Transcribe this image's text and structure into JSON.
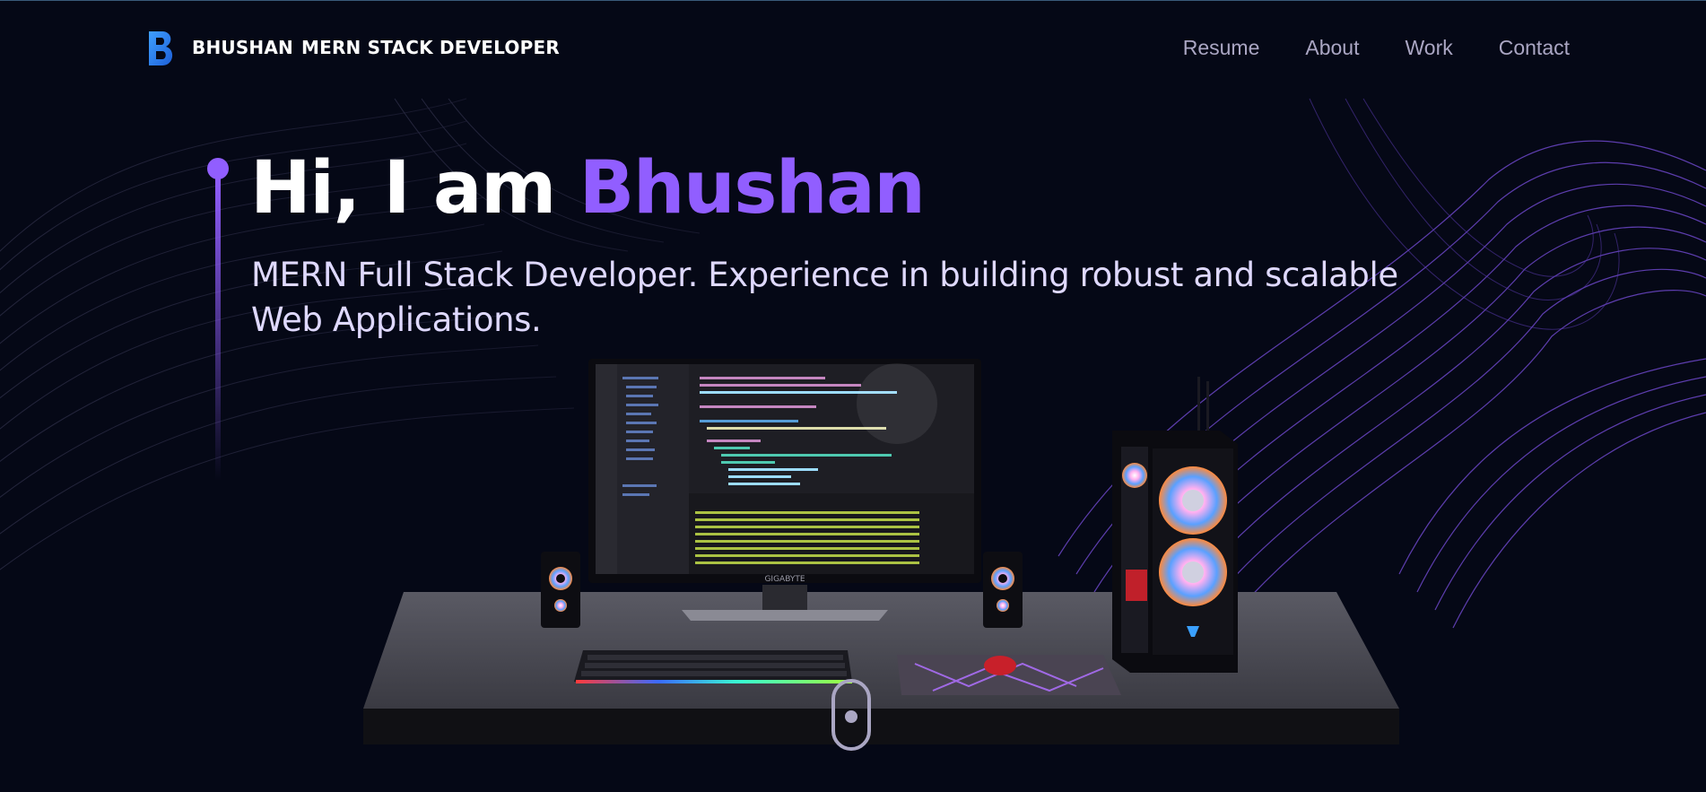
{
  "brand": {
    "first": "BHUSHAN",
    "second": "MERN STACK DEVELOPER",
    "logo_icon": "b-logo-icon"
  },
  "nav": {
    "items": [
      {
        "label": "Resume"
      },
      {
        "label": "About"
      },
      {
        "label": "Work"
      },
      {
        "label": "Contact"
      }
    ]
  },
  "hero": {
    "greeting": "Hi, I am ",
    "name": "Bhushan",
    "subtitle": "MERN Full Stack Developer. Experience in building robust and scalable Web Applications."
  },
  "scene": {
    "monitor_brand": "GIGABYTE"
  },
  "colors": {
    "background": "#050816",
    "accent": "#915eff",
    "nav_text": "#aaa6c3",
    "subtitle_text": "#dfd9ff"
  }
}
